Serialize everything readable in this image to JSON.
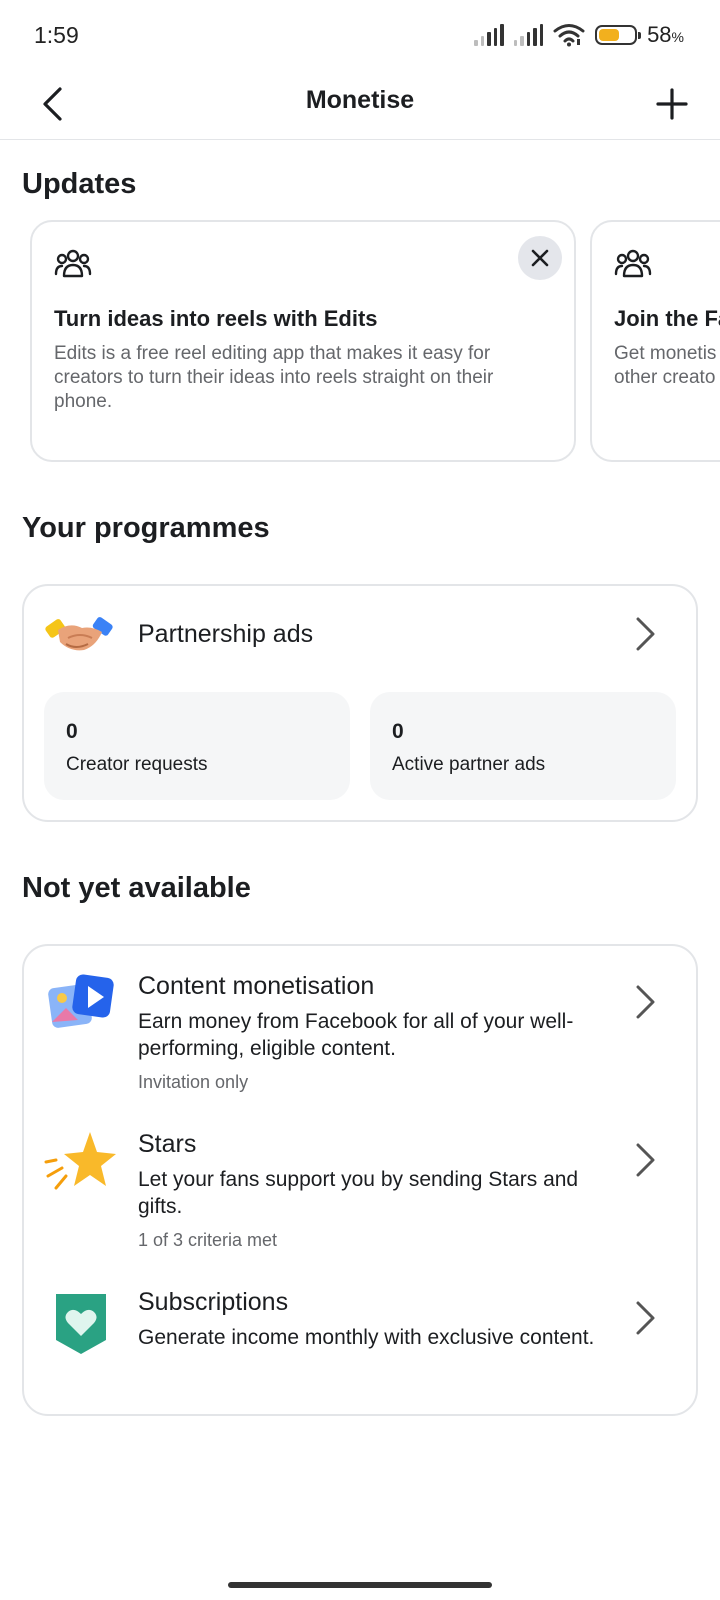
{
  "status_bar": {
    "time": "1:59",
    "battery_percent": "58",
    "battery_unit": "%",
    "battery_level": 0.58
  },
  "header": {
    "title": "Monetise",
    "back_icon": "chevron-left-icon",
    "add_icon": "plus-icon"
  },
  "updates": {
    "title": "Updates",
    "cards": [
      {
        "icon": "people-group-icon",
        "title": "Turn ideas into reels with Edits",
        "body": "Edits is a free reel editing app that makes it easy for creators to turn their ideas into reels straight on their phone."
      },
      {
        "icon": "people-group-icon",
        "title": "Join the Fa",
        "body": "Get monetis other creato"
      }
    ]
  },
  "programmes": {
    "title": "Your programmes",
    "item": {
      "label": "Partnership ads",
      "icon": "handshake-icon"
    },
    "stats": [
      {
        "value": "0",
        "label": "Creator requests"
      },
      {
        "value": "0",
        "label": "Active partner ads"
      }
    ]
  },
  "not_available": {
    "title": "Not yet available",
    "items": [
      {
        "title": "Content monetisation",
        "desc": "Earn money from Facebook for all of your well-performing, eligible content.",
        "meta": "Invitation only",
        "icon": "media-play-icon"
      },
      {
        "title": "Stars",
        "desc": "Let your fans support you by sending Stars and gifts.",
        "meta": "1 of 3 criteria met",
        "icon": "star-icon"
      },
      {
        "title": "Subscriptions",
        "desc": "Generate income monthly with exclusive content.",
        "meta": "",
        "icon": "heart-shield-icon"
      }
    ]
  },
  "colors": {
    "accent_battery": "#f2b01e",
    "subscriptions_green": "#2aa283",
    "border": "#e3e5e8",
    "secondary_text": "#65676b"
  }
}
